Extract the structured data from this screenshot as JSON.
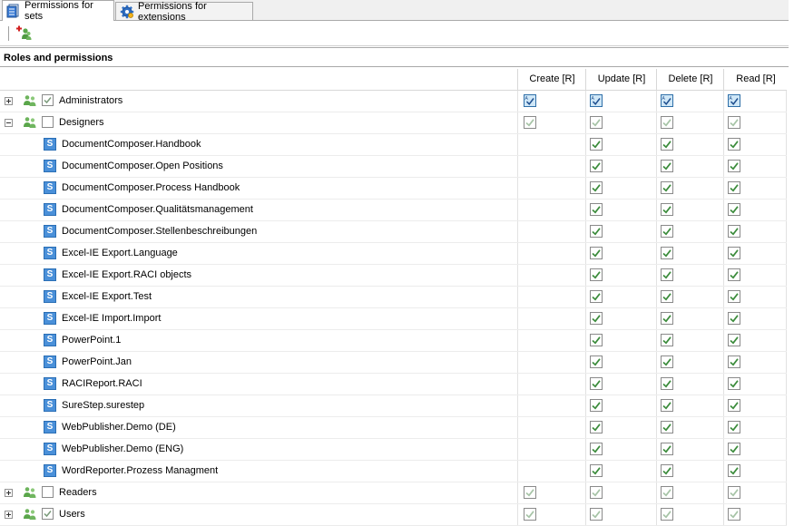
{
  "tabs": [
    {
      "label": "Permissions for sets",
      "icon": "document-set-icon",
      "active": true
    },
    {
      "label": "Permissions for extensions",
      "icon": "gear-icon",
      "active": false
    }
  ],
  "toolbar": {
    "add_role_icon": "add-group-icon"
  },
  "section_title": "Roles and permissions",
  "columns": [
    "Create [R]",
    "Update [R]",
    "Delete [R]",
    "Read [R]"
  ],
  "rows": [
    {
      "kind": "role",
      "label": "Administrators",
      "expanded": false,
      "checked": true,
      "perms": [
        "admin",
        "admin",
        "admin",
        "admin"
      ]
    },
    {
      "kind": "role",
      "label": "Designers",
      "expanded": true,
      "checked": false,
      "perms": [
        "light",
        "light",
        "light",
        "light"
      ]
    },
    {
      "kind": "set",
      "label": "DocumentComposer.Handbook",
      "perms": [
        "",
        "green",
        "green",
        "green"
      ]
    },
    {
      "kind": "set",
      "label": "DocumentComposer.Open Positions",
      "perms": [
        "",
        "green",
        "green",
        "green"
      ]
    },
    {
      "kind": "set",
      "label": "DocumentComposer.Process Handbook",
      "perms": [
        "",
        "green",
        "green",
        "green"
      ]
    },
    {
      "kind": "set",
      "label": "DocumentComposer.Qualitätsmanagement",
      "perms": [
        "",
        "green",
        "green",
        "green"
      ]
    },
    {
      "kind": "set",
      "label": "DocumentComposer.Stellenbeschreibungen",
      "perms": [
        "",
        "green",
        "green",
        "green"
      ]
    },
    {
      "kind": "set",
      "label": "Excel-IE Export.Language",
      "perms": [
        "",
        "green",
        "green",
        "green"
      ]
    },
    {
      "kind": "set",
      "label": "Excel-IE Export.RACI objects",
      "perms": [
        "",
        "green",
        "green",
        "green"
      ]
    },
    {
      "kind": "set",
      "label": "Excel-IE Export.Test",
      "perms": [
        "",
        "green",
        "green",
        "green"
      ]
    },
    {
      "kind": "set",
      "label": "Excel-IE Import.Import",
      "perms": [
        "",
        "green",
        "green",
        "green"
      ]
    },
    {
      "kind": "set",
      "label": "PowerPoint.1",
      "perms": [
        "",
        "green",
        "green",
        "green"
      ]
    },
    {
      "kind": "set",
      "label": "PowerPoint.Jan",
      "perms": [
        "",
        "green",
        "green",
        "green"
      ]
    },
    {
      "kind": "set",
      "label": "RACIReport.RACI",
      "perms": [
        "",
        "green",
        "green",
        "green"
      ]
    },
    {
      "kind": "set",
      "label": "SureStep.surestep",
      "perms": [
        "",
        "green",
        "green",
        "green"
      ]
    },
    {
      "kind": "set",
      "label": "WebPublisher.Demo (DE)",
      "perms": [
        "",
        "green",
        "green",
        "green"
      ]
    },
    {
      "kind": "set",
      "label": "WebPublisher.Demo (ENG)",
      "perms": [
        "",
        "green",
        "green",
        "green"
      ]
    },
    {
      "kind": "set",
      "label": "WordReporter.Prozess Managment",
      "perms": [
        "",
        "green",
        "green",
        "green"
      ]
    },
    {
      "kind": "role",
      "label": "Readers",
      "expanded": false,
      "checked": false,
      "perms": [
        "light",
        "light",
        "light",
        "light"
      ]
    },
    {
      "kind": "role",
      "label": "Users",
      "expanded": false,
      "checked": true,
      "perms": [
        "light",
        "light",
        "light",
        "light"
      ]
    }
  ],
  "colors": {
    "set_icon": "#4a90d9",
    "check_green": "#3c8c3c",
    "check_light": "#a7c4a7",
    "admin_box": "#cfe7f7"
  }
}
